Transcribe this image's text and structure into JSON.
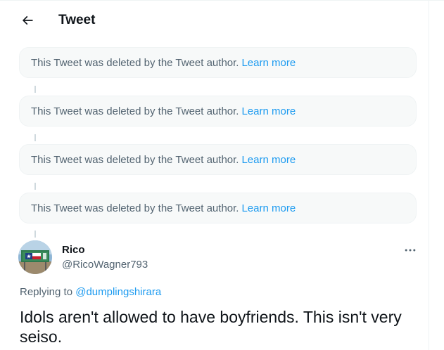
{
  "header": {
    "title": "Tweet",
    "back_icon": "arrow-left-icon"
  },
  "deleted_tweets": [
    {
      "text": "This Tweet was deleted by the Tweet author.",
      "link": "Learn more"
    },
    {
      "text": "This Tweet was deleted by the Tweet author.",
      "link": "Learn more"
    },
    {
      "text": "This Tweet was deleted by the Tweet author.",
      "link": "Learn more"
    },
    {
      "text": "This Tweet was deleted by the Tweet author.",
      "link": "Learn more"
    }
  ],
  "tweet": {
    "author_name": "Rico",
    "author_handle": "@RicoWagner793",
    "replying_prefix": "Replying to",
    "replying_to": "@dumplingshirara",
    "text": "Idols aren't allowed to have boyfriends. This isn't very seiso.",
    "more_icon": "more-horizontal-icon"
  },
  "colors": {
    "accent": "#1d9bf0",
    "secondary_text": "#536471",
    "primary_text": "#0f1419",
    "card_bg": "#f7f9f9"
  }
}
